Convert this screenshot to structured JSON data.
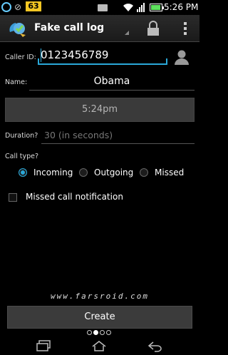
{
  "status_bar": {
    "badge_number": "63",
    "time": "5:26 PM",
    "battery_level": 0.8,
    "icons": [
      "timer-icon",
      "mute-icon",
      "number-badge",
      "mail-icon",
      "wifi-icon",
      "signal-icon",
      "battery-icon"
    ]
  },
  "action_bar": {
    "title": "Fake call log",
    "icons": [
      "app-icon",
      "lock-icon",
      "overflow-menu-icon"
    ]
  },
  "form": {
    "caller_id_label": "Caller ID:",
    "caller_id_value": "0123456789",
    "name_label": "Name:",
    "name_value": "Obama",
    "time_value": "5:24pm",
    "duration_label": "Duration?",
    "duration_placeholder": "30 (in seconds)",
    "call_type_label": "Call type?",
    "call_types": [
      {
        "label": "Incoming",
        "selected": true
      },
      {
        "label": "Outgoing",
        "selected": false
      },
      {
        "label": "Missed",
        "selected": false
      }
    ],
    "missed_notification_label": "Missed call notification",
    "missed_notification_checked": false
  },
  "watermark": "www.farsroid.com",
  "create_button": "Create",
  "pager": {
    "count": 4,
    "active_index": 1
  },
  "colors": {
    "accent": "#2aa8d8",
    "background": "#000000",
    "button": "#3b3b3b"
  },
  "nav_icons": [
    "recent-apps-icon",
    "home-icon",
    "back-icon"
  ]
}
